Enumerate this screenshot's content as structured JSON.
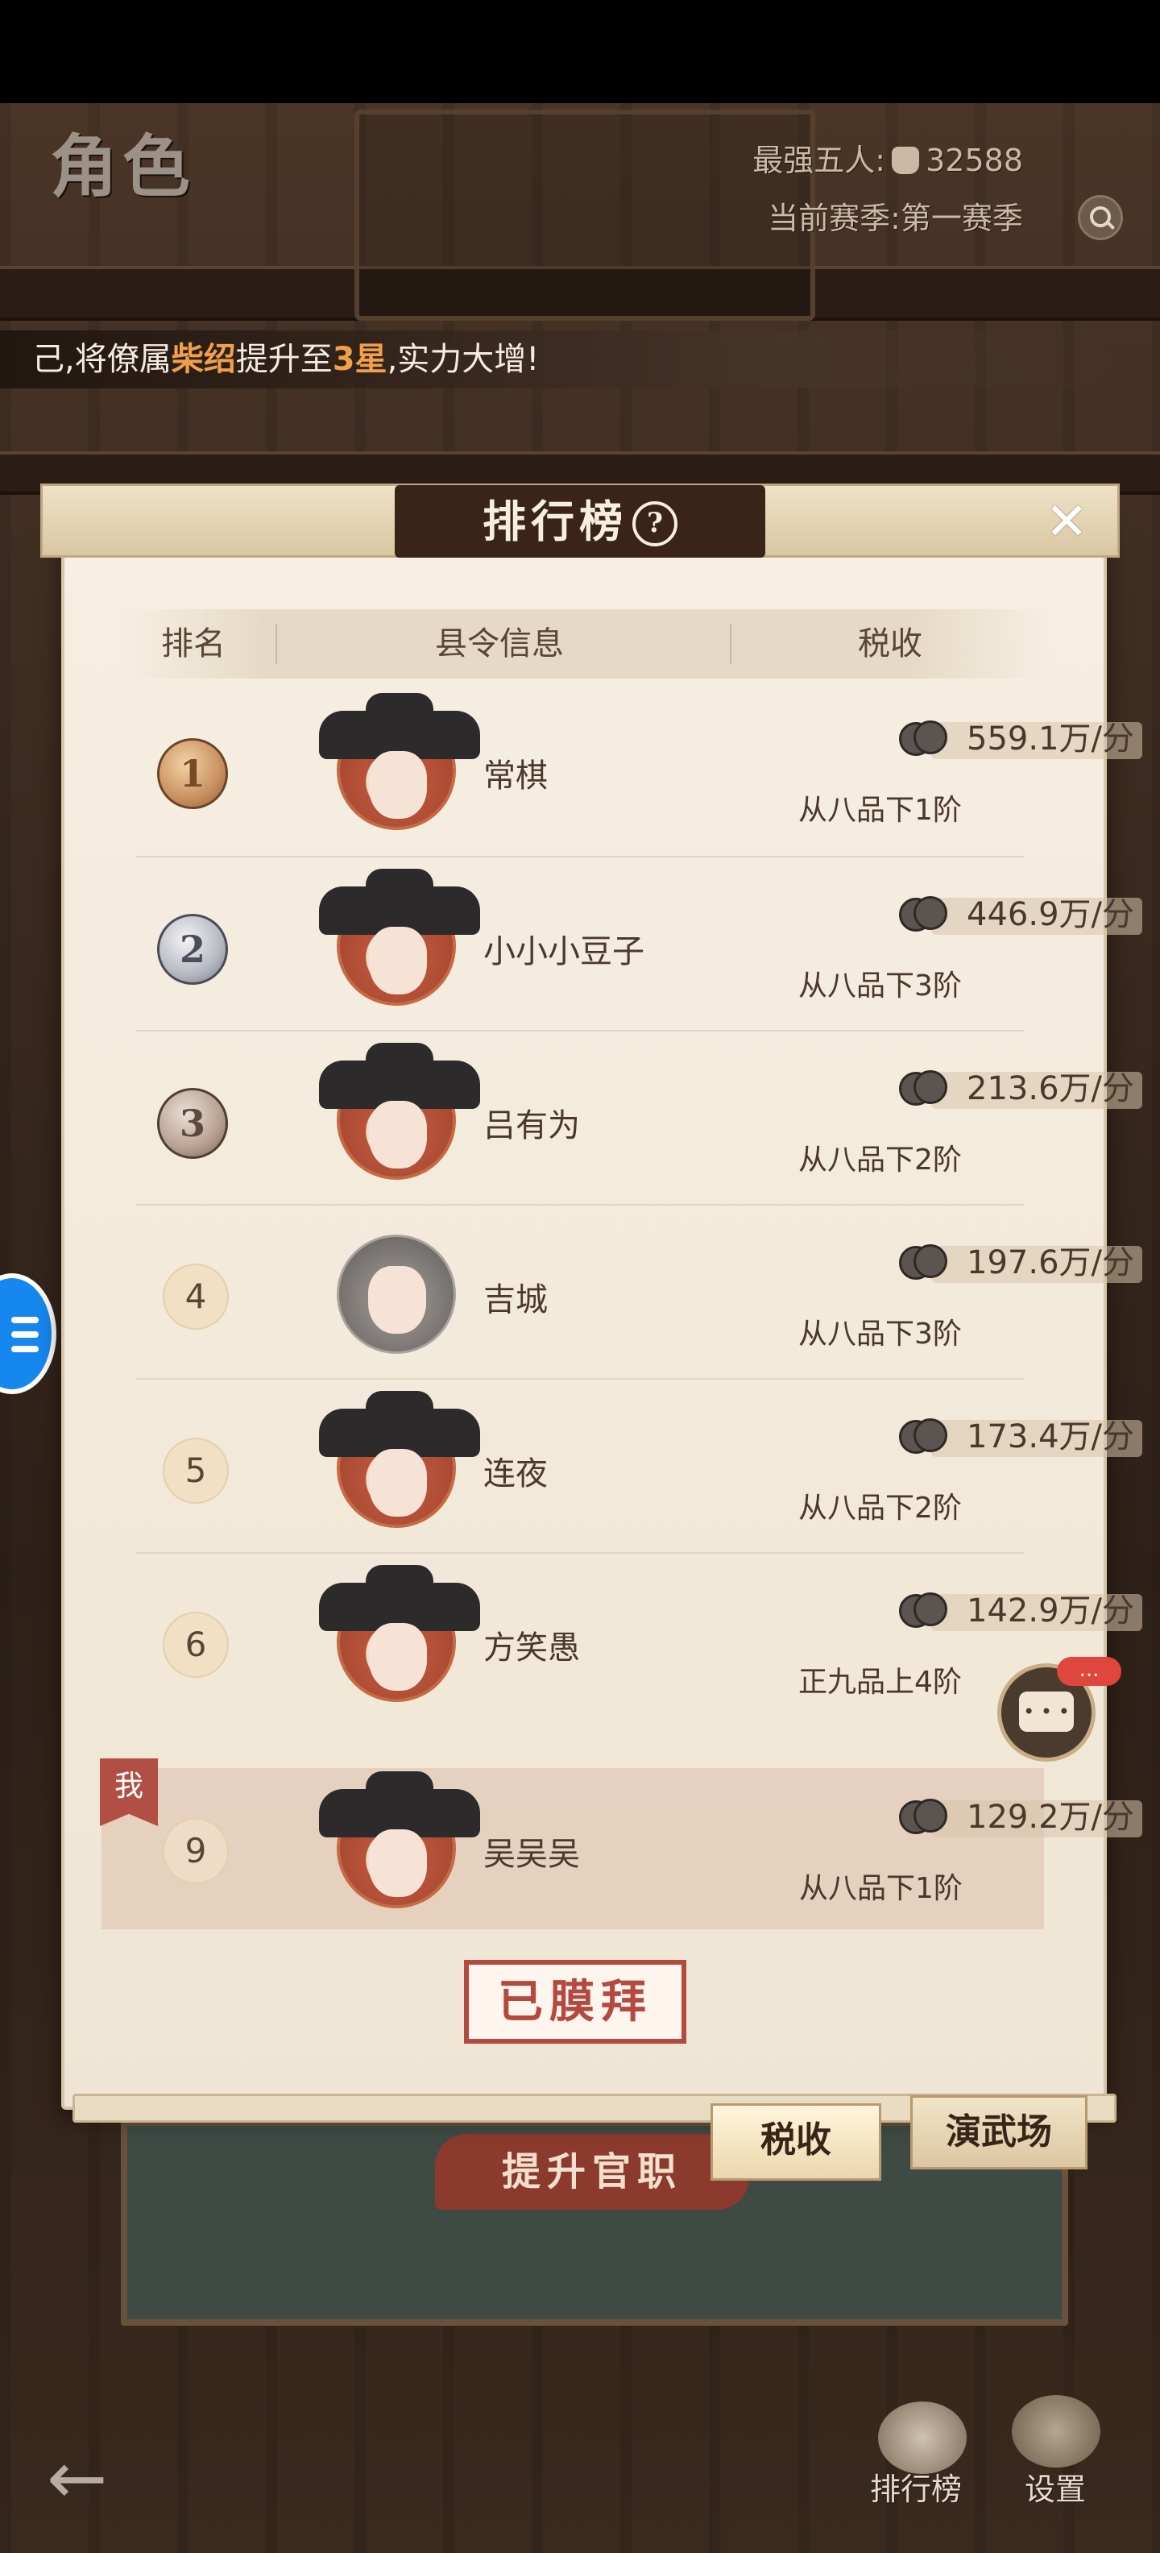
{
  "screen": {
    "title": "角色",
    "top_info": {
      "strongest_label": "最强五人:",
      "strongest_value": "32588",
      "season_label": "当前赛季:",
      "season_value": "第一赛季"
    }
  },
  "ticker": {
    "prefix": "己,将僚属",
    "name": "柴绍",
    "middle": "提升至",
    "star": "3星",
    "suffix": ",实力大增!"
  },
  "modal": {
    "title": "排行榜",
    "help_icon": "question-icon",
    "close_icon": "close-icon",
    "columns": [
      "排名",
      "县令信息",
      "税收"
    ],
    "rows": [
      {
        "rank": "1",
        "name": "常棋",
        "tax": "559.1万/分",
        "rank_title": "从八品下1阶",
        "medal": "gold"
      },
      {
        "rank": "2",
        "name": "小小小豆子",
        "tax": "446.9万/分",
        "rank_title": "从八品下3阶",
        "medal": "silver"
      },
      {
        "rank": "3",
        "name": "吕有为",
        "tax": "213.6万/分",
        "rank_title": "从八品下2阶",
        "medal": "bronze"
      },
      {
        "rank": "4",
        "name": "吉城",
        "tax": "197.6万/分",
        "rank_title": "从八品下3阶",
        "medal": "none"
      },
      {
        "rank": "5",
        "name": "连夜",
        "tax": "173.4万/分",
        "rank_title": "从八品下2阶",
        "medal": "none"
      },
      {
        "rank": "6",
        "name": "方笑愚",
        "tax": "142.9万/分",
        "rank_title": "正九品上4阶",
        "medal": "none"
      }
    ],
    "my_row": {
      "tag": "我",
      "rank": "9",
      "name": "吴吴吴",
      "tax": "129.2万/分",
      "rank_title": "从八品下1阶"
    },
    "bow_button": "已膜拜",
    "tabs": {
      "tax": "税收",
      "arena": "演武场"
    }
  },
  "background": {
    "promote_button": "提升官职",
    "chat_badge": "..."
  },
  "bottom_nav": {
    "ranking": "排行榜",
    "settings": "设置"
  }
}
